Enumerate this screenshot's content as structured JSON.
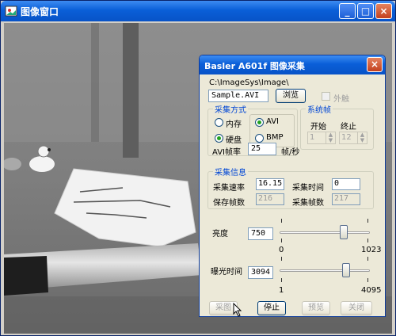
{
  "main": {
    "title": "图像窗口",
    "buttons": {
      "minimize": "_",
      "maximize": "□",
      "close": "×"
    }
  },
  "dialog": {
    "title": "Basler A601f 图像采集",
    "close": "×",
    "path": "C:\\ImageSys\\Image\\",
    "filename": "Sample.AVI",
    "browse_label": "浏览",
    "external_trigger_label": "外触",
    "capture_mode": {
      "caption": "采集方式",
      "options": [
        "内存",
        "硬盘",
        "AVI",
        "BMP"
      ],
      "selected_storage": "硬盘",
      "selected_format": "AVI",
      "avi_rate_label": "AVI帧率",
      "avi_rate_value": "25",
      "avi_rate_unit": "帧/秒"
    },
    "system_frames": {
      "caption": "系统帧",
      "start_label": "开始",
      "end_label": "终止",
      "start_value": "1",
      "end_value": "12"
    },
    "capture_info": {
      "caption": "采集信息",
      "speed_label": "采集速率",
      "speed_value": "16.15",
      "time_label": "采集时间",
      "time_value": "0",
      "saved_label": "保存帧数",
      "saved_value": "216",
      "captured_label": "采集帧数",
      "captured_value": "217"
    },
    "brightness": {
      "label": "亮度",
      "value": "750",
      "min": "0",
      "max": "1023",
      "level": 0.733
    },
    "exposure": {
      "label": "曝光时间",
      "value": "3094",
      "min": "1",
      "max": "4095",
      "level": 0.755
    },
    "buttons": {
      "capture": "采图",
      "stop": "停止",
      "preview": "预览",
      "close": "关闭"
    }
  },
  "colors": {
    "titlebar": "#0a5fd8",
    "dialog_bg": "#ece9d8",
    "group_caption": "#0046d5"
  }
}
